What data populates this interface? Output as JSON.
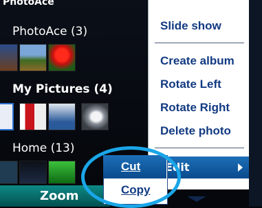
{
  "app": {
    "title": "PhotoAce"
  },
  "albums": [
    {
      "label": "PhotoAce (3)"
    },
    {
      "label": "My Pictures (4)"
    },
    {
      "label": "Home (13)"
    }
  ],
  "menu": {
    "items": [
      "Slide show",
      "Create album",
      "Rotate Left",
      "Rotate Right",
      "Delete photo"
    ],
    "edit_label": "Edit"
  },
  "submenu": {
    "items": [
      "Cut",
      "Copy"
    ]
  },
  "softkeys": {
    "left": "Zoom"
  },
  "colors": {
    "menu_text": "#123a82",
    "highlight": "#1d6fb8",
    "circle": "#1aa6e8",
    "softkey": "#0d8a86"
  }
}
